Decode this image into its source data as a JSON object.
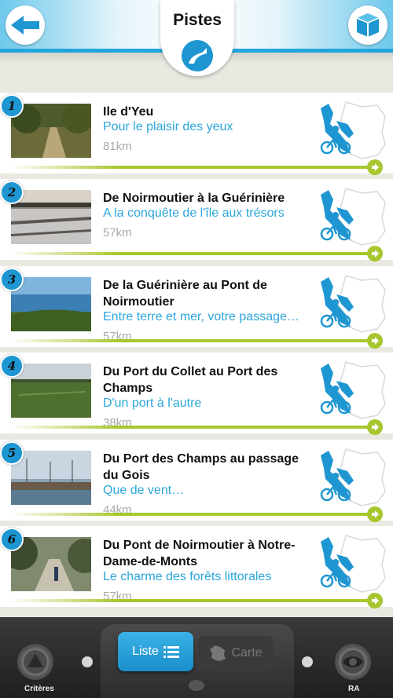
{
  "header": {
    "title": "Pistes",
    "back_icon": "arrow-left-icon",
    "cube_icon": "cube-icon",
    "road_icon": "road-icon",
    "accent": "#21a6dc"
  },
  "routes": [
    {
      "number": "1",
      "title": "Ile d'Yeu",
      "subtitle": "Pour le plaisir des yeux",
      "distance": "81km"
    },
    {
      "number": "2",
      "title": "De Noirmoutier à la Guérinière",
      "subtitle": "A la conquête de l'île aux trésors",
      "distance": "57km"
    },
    {
      "number": "3",
      "title": "De la Guérinière au Pont de Noirmoutier",
      "subtitle": "Entre terre et mer, votre passage…",
      "distance": "57km"
    },
    {
      "number": "4",
      "title": "Du Port du Collet au Port des Champs",
      "subtitle": "D'un port à l'autre",
      "distance": "38km"
    },
    {
      "number": "5",
      "title": "Du Port des Champs au passage du Gois",
      "subtitle": "Que de vent…",
      "distance": "44km"
    },
    {
      "number": "6",
      "title": "Du Pont de Noirmoutier à Notre-Dame-de-Monts",
      "subtitle": "Le charme des forêts littorales",
      "distance": "57km"
    }
  ],
  "bottom_bar": {
    "left_label": "Critères",
    "right_label": "RA",
    "list_label": "Liste",
    "map_label": "Carte",
    "active_tab": "Liste"
  },
  "colors": {
    "blue": "#1e96d2",
    "green": "#a6c72d",
    "subtitle": "#2ba6dc"
  }
}
